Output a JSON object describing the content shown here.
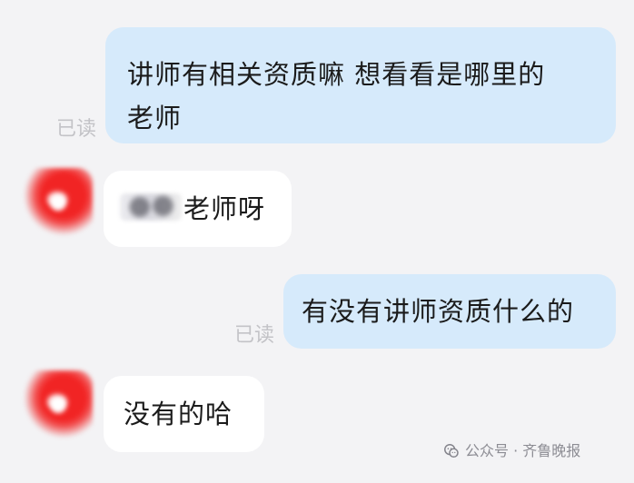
{
  "messages": [
    {
      "direction": "outgoing",
      "lines": [
        "讲师有相关资质嘛 想看看是哪里的",
        "老师"
      ],
      "read_label": "已读"
    },
    {
      "direction": "incoming",
      "text": "老师呀"
    },
    {
      "direction": "outgoing",
      "text": "有没有讲师资质什么的",
      "read_label": "已读"
    },
    {
      "direction": "incoming",
      "text": "没有的哈"
    }
  ],
  "watermark": {
    "text": "公众号 · 齐鲁晚报"
  },
  "colors": {
    "background": "#f3f3f5",
    "outgoing_bubble": "#d6eafb",
    "incoming_bubble": "#ffffff",
    "avatar": "#f12424",
    "read_receipt": "#c3c3c7"
  },
  "icons": {
    "watermark_icon": "wechat-official-account-icon"
  }
}
